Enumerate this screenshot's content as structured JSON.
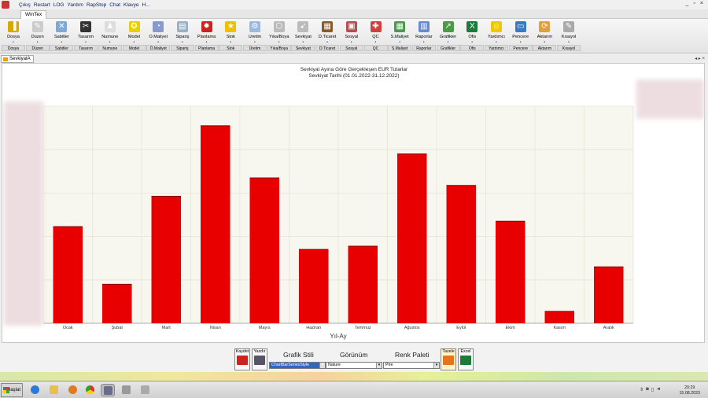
{
  "window": {
    "menu": [
      "Çıkış",
      "Restart",
      "LOG",
      "Yardım",
      "RapStop",
      "Chat",
      "Klavye",
      "H..."
    ],
    "controls": [
      "_",
      "▫",
      "×"
    ],
    "tab": "WinTex"
  },
  "ribbon": [
    {
      "label": "Dosya",
      "group": "Dosya",
      "icon": "folder-icon",
      "color": "#d8a800",
      "glyph": "▐"
    },
    {
      "label": "Düzen",
      "group": "Düzen",
      "icon": "edit-icon",
      "color": "#cccccc",
      "glyph": "✎"
    },
    {
      "label": "Sabitler",
      "group": "Sabitler",
      "icon": "tools-icon",
      "color": "#7fa8d8",
      "glyph": "✕"
    },
    {
      "label": "Tasarım",
      "group": "Tasarım",
      "icon": "design-icon",
      "color": "#333333",
      "glyph": "✂"
    },
    {
      "label": "Numune",
      "group": "Numune",
      "icon": "sample-icon",
      "color": "#dddddd",
      "glyph": "♟"
    },
    {
      "label": "Model",
      "group": "Model",
      "icon": "model-icon",
      "color": "#e8d000",
      "glyph": "✪"
    },
    {
      "label": "Ö.Maliyet",
      "group": "Ö.Maliyet",
      "icon": "cost-icon",
      "color": "#8899cc",
      "glyph": "◔"
    },
    {
      "label": "Sipariş",
      "group": "Sipariş",
      "icon": "order-icon",
      "color": "#9ab0c8",
      "glyph": "▤"
    },
    {
      "label": "Planlama",
      "group": "Planlama",
      "icon": "planning-icon",
      "color": "#cc2222",
      "glyph": "✹"
    },
    {
      "label": "Stok",
      "group": "Stok",
      "icon": "star-icon",
      "color": "#f0c000",
      "glyph": "★"
    },
    {
      "label": "Üretim",
      "group": "Üretim",
      "icon": "production-icon",
      "color": "#9ab8e0",
      "glyph": "⚙"
    },
    {
      "label": "Yıka/Boya",
      "group": "Yıka/Boya",
      "icon": "wash-icon",
      "color": "#bbbbbb",
      "glyph": "⬡"
    },
    {
      "label": "Sevkiyat",
      "group": "Sevkiyat",
      "icon": "shipping-icon",
      "color": "#bbbbbb",
      "glyph": "➹"
    },
    {
      "label": "D.Ticaret",
      "group": "D.Ticaret",
      "icon": "trade-icon",
      "color": "#8a5a2a",
      "glyph": "▦"
    },
    {
      "label": "Sosyal",
      "group": "Sosyal",
      "icon": "social-icon",
      "color": "#b05050",
      "glyph": "▣"
    },
    {
      "label": "QC",
      "group": "QC",
      "icon": "qc-icon",
      "color": "#d04040",
      "glyph": "✚"
    },
    {
      "label": "S.Maliyet",
      "group": "S.Maliyet",
      "icon": "calc-icon",
      "color": "#4a9a4a",
      "glyph": "▦"
    },
    {
      "label": "Raporlar",
      "group": "Raporlar",
      "icon": "report-icon",
      "color": "#6a8ad0",
      "glyph": "▥"
    },
    {
      "label": "Grafikler",
      "group": "Grafikler",
      "icon": "chart-icon",
      "color": "#4a9a4a",
      "glyph": "↗"
    },
    {
      "label": "Ofis",
      "group": "Ofis",
      "icon": "excel-icon",
      "color": "#1d7a3a",
      "glyph": "X"
    },
    {
      "label": "Yardımcı",
      "group": "Yardımcı",
      "icon": "smiley-icon",
      "color": "#f0c800",
      "glyph": "☺"
    },
    {
      "label": "Pencere",
      "group": "Pencere",
      "icon": "window-icon",
      "color": "#3a78c8",
      "glyph": "▭"
    },
    {
      "label": "Aktarım",
      "group": "Aktarım",
      "icon": "transfer-icon",
      "color": "#e0a040",
      "glyph": "⟳"
    },
    {
      "label": "Kısayol",
      "group": "Kısayol",
      "icon": "shortcut-icon",
      "color": "#aaaaaa",
      "glyph": "✎"
    }
  ],
  "doc_tab": {
    "label": "SevkiyatA",
    "controls": "◂ ▸ ×"
  },
  "chart_data": {
    "type": "bar",
    "title": "Sevkiyat Ayına Göre Gerçekleşen EUR Tutarlar",
    "subtitle": "Sevkiyat Tarihi (01.01.2022-31.12.2022)",
    "xlabel": "Yıl-Ay",
    "ylabel": "",
    "categories": [
      "Ocak",
      "Şubat",
      "Mart",
      "Nisan",
      "Mayıs",
      "Haziran",
      "Temmuz",
      "Ağustos",
      "Eylül",
      "Ekim",
      "Kasım",
      "Aralık"
    ],
    "values": [
      44.5,
      18.0,
      58.5,
      91.0,
      67.0,
      34.0,
      35.5,
      78.0,
      63.5,
      47.0,
      5.5,
      26.0
    ],
    "ylim": [
      0,
      100
    ],
    "grid": true,
    "bar_color": "#e80000"
  },
  "bottom": {
    "save_label": "Kaydet",
    "print_label": "Yazdır",
    "style_label": "Grafik Stili",
    "style_value": "ChartBarSeriesStyle",
    "view_label": "Görünüm",
    "view_value": "Nature",
    "palette_label": "Renk Paleti",
    "palette_value": "Pire",
    "refresh_label": "Tazele",
    "excel_label": "Excel"
  },
  "taskbar": {
    "start_label": "Başlat",
    "time": "20:29",
    "date": "15.08.2023"
  }
}
